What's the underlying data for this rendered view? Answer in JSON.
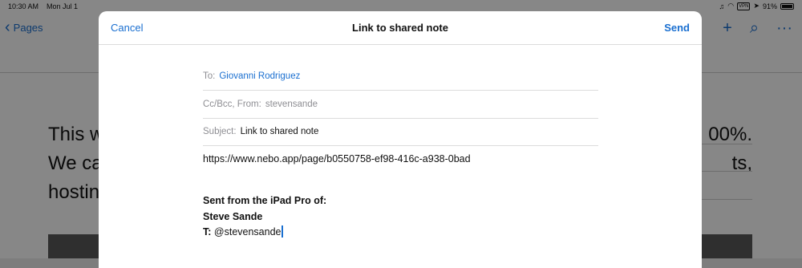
{
  "status_bar": {
    "time": "10:30 AM",
    "date": "Mon Jul 1",
    "vpn": "VPN",
    "battery": "91%"
  },
  "background": {
    "back_label": "Pages",
    "page_lines_left": [
      "This w",
      "We ca",
      "hostin"
    ],
    "page_lines_right": [
      "00%.",
      "ts,",
      ""
    ]
  },
  "sheet": {
    "cancel": "Cancel",
    "title": "Link to shared note",
    "send": "Send",
    "to_label": "To:",
    "to_value": "Giovanni Rodriguez",
    "cc_label": "Cc/Bcc, From:",
    "cc_value": "stevensande",
    "subject_label": "Subject:",
    "subject_value": "Link to shared note",
    "body_link": "https://www.nebo.app/page/b0550758-ef98-416c-a938-0bad",
    "sig_line1": "Sent from the iPad Pro of:",
    "sig_line2": "Steve Sande",
    "sig_prefix": "T:",
    "sig_handle": "@stevensande"
  },
  "colors": {
    "accent": "#1a6fd0",
    "label_gray": "#8e8e93"
  }
}
